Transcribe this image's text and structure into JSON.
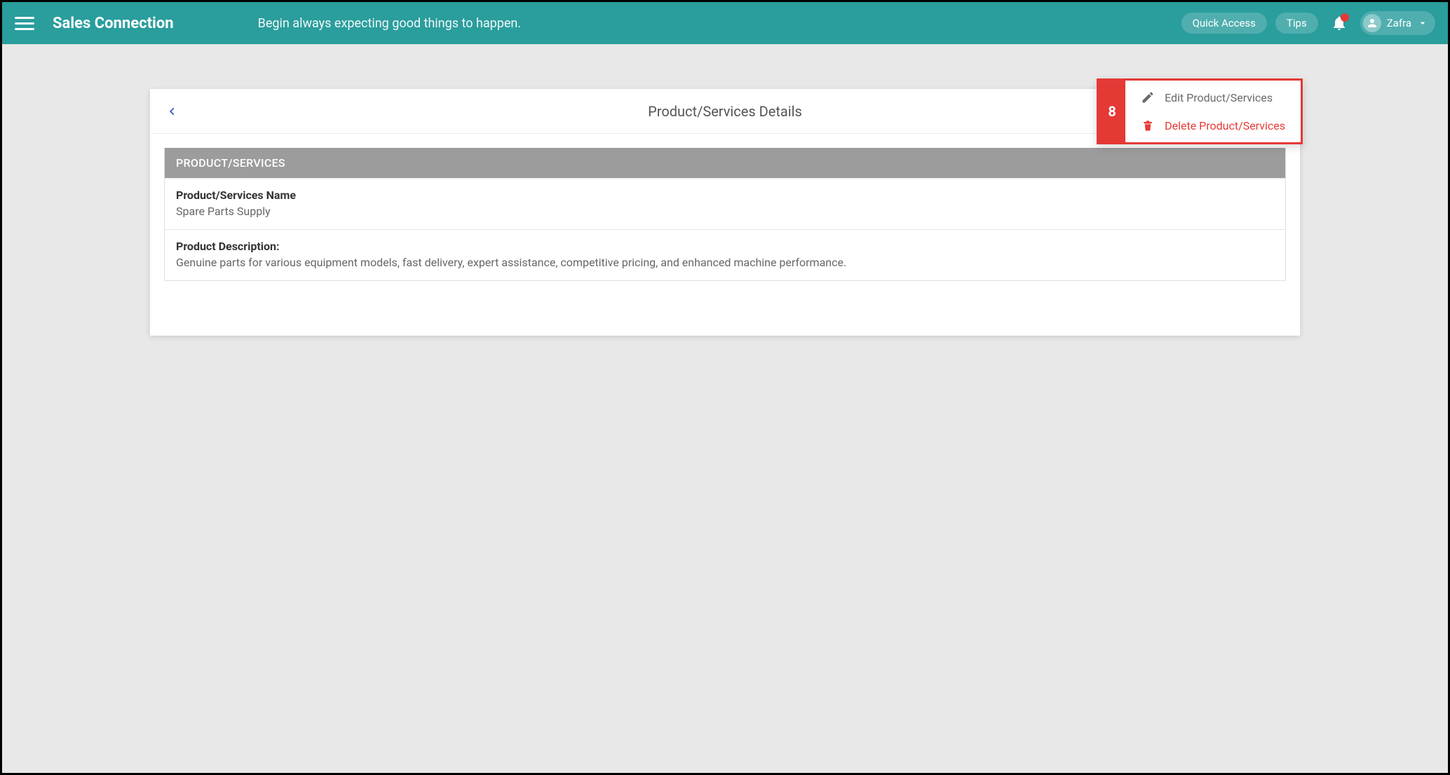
{
  "topbar": {
    "brand": "Sales Connection",
    "banner_message": "Begin always expecting good things to happen.",
    "quick_access_label": "Quick Access",
    "tips_label": "Tips",
    "user_name": "Zafra"
  },
  "page": {
    "title": "Product/Services Details",
    "section_header": "PRODUCT/SERVICES",
    "fields": {
      "name_label": "Product/Services Name",
      "name_value": "Spare Parts Supply",
      "desc_label": "Product Description:",
      "desc_value": "Genuine parts for various equipment models, fast delivery, expert assistance, competitive pricing, and enhanced machine performance."
    }
  },
  "context_menu": {
    "badge": "8",
    "edit_label": "Edit Product/Services",
    "delete_label": "Delete Product/Services"
  }
}
